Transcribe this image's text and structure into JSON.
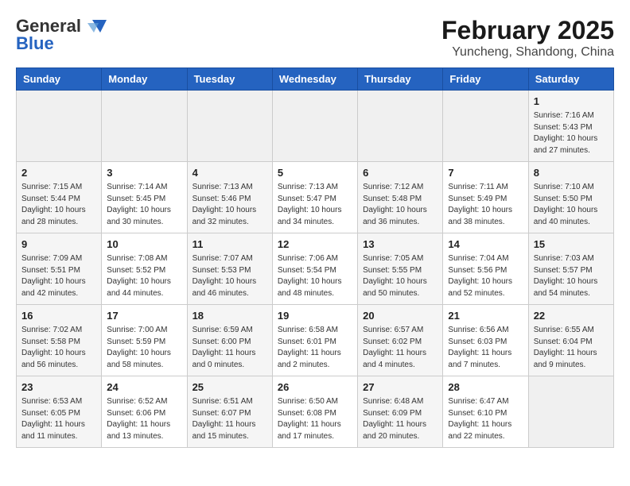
{
  "header": {
    "logo_general": "General",
    "logo_blue": "Blue",
    "title": "February 2025",
    "subtitle": "Yuncheng, Shandong, China"
  },
  "weekdays": [
    "Sunday",
    "Monday",
    "Tuesday",
    "Wednesday",
    "Thursday",
    "Friday",
    "Saturday"
  ],
  "weeks": [
    [
      {
        "day": "",
        "info": ""
      },
      {
        "day": "",
        "info": ""
      },
      {
        "day": "",
        "info": ""
      },
      {
        "day": "",
        "info": ""
      },
      {
        "day": "",
        "info": ""
      },
      {
        "day": "",
        "info": ""
      },
      {
        "day": "1",
        "info": "Sunrise: 7:16 AM\nSunset: 5:43 PM\nDaylight: 10 hours\nand 27 minutes."
      }
    ],
    [
      {
        "day": "2",
        "info": "Sunrise: 7:15 AM\nSunset: 5:44 PM\nDaylight: 10 hours\nand 28 minutes."
      },
      {
        "day": "3",
        "info": "Sunrise: 7:14 AM\nSunset: 5:45 PM\nDaylight: 10 hours\nand 30 minutes."
      },
      {
        "day": "4",
        "info": "Sunrise: 7:13 AM\nSunset: 5:46 PM\nDaylight: 10 hours\nand 32 minutes."
      },
      {
        "day": "5",
        "info": "Sunrise: 7:13 AM\nSunset: 5:47 PM\nDaylight: 10 hours\nand 34 minutes."
      },
      {
        "day": "6",
        "info": "Sunrise: 7:12 AM\nSunset: 5:48 PM\nDaylight: 10 hours\nand 36 minutes."
      },
      {
        "day": "7",
        "info": "Sunrise: 7:11 AM\nSunset: 5:49 PM\nDaylight: 10 hours\nand 38 minutes."
      },
      {
        "day": "8",
        "info": "Sunrise: 7:10 AM\nSunset: 5:50 PM\nDaylight: 10 hours\nand 40 minutes."
      }
    ],
    [
      {
        "day": "9",
        "info": "Sunrise: 7:09 AM\nSunset: 5:51 PM\nDaylight: 10 hours\nand 42 minutes."
      },
      {
        "day": "10",
        "info": "Sunrise: 7:08 AM\nSunset: 5:52 PM\nDaylight: 10 hours\nand 44 minutes."
      },
      {
        "day": "11",
        "info": "Sunrise: 7:07 AM\nSunset: 5:53 PM\nDaylight: 10 hours\nand 46 minutes."
      },
      {
        "day": "12",
        "info": "Sunrise: 7:06 AM\nSunset: 5:54 PM\nDaylight: 10 hours\nand 48 minutes."
      },
      {
        "day": "13",
        "info": "Sunrise: 7:05 AM\nSunset: 5:55 PM\nDaylight: 10 hours\nand 50 minutes."
      },
      {
        "day": "14",
        "info": "Sunrise: 7:04 AM\nSunset: 5:56 PM\nDaylight: 10 hours\nand 52 minutes."
      },
      {
        "day": "15",
        "info": "Sunrise: 7:03 AM\nSunset: 5:57 PM\nDaylight: 10 hours\nand 54 minutes."
      }
    ],
    [
      {
        "day": "16",
        "info": "Sunrise: 7:02 AM\nSunset: 5:58 PM\nDaylight: 10 hours\nand 56 minutes."
      },
      {
        "day": "17",
        "info": "Sunrise: 7:00 AM\nSunset: 5:59 PM\nDaylight: 10 hours\nand 58 minutes."
      },
      {
        "day": "18",
        "info": "Sunrise: 6:59 AM\nSunset: 6:00 PM\nDaylight: 11 hours\nand 0 minutes."
      },
      {
        "day": "19",
        "info": "Sunrise: 6:58 AM\nSunset: 6:01 PM\nDaylight: 11 hours\nand 2 minutes."
      },
      {
        "day": "20",
        "info": "Sunrise: 6:57 AM\nSunset: 6:02 PM\nDaylight: 11 hours\nand 4 minutes."
      },
      {
        "day": "21",
        "info": "Sunrise: 6:56 AM\nSunset: 6:03 PM\nDaylight: 11 hours\nand 7 minutes."
      },
      {
        "day": "22",
        "info": "Sunrise: 6:55 AM\nSunset: 6:04 PM\nDaylight: 11 hours\nand 9 minutes."
      }
    ],
    [
      {
        "day": "23",
        "info": "Sunrise: 6:53 AM\nSunset: 6:05 PM\nDaylight: 11 hours\nand 11 minutes."
      },
      {
        "day": "24",
        "info": "Sunrise: 6:52 AM\nSunset: 6:06 PM\nDaylight: 11 hours\nand 13 minutes."
      },
      {
        "day": "25",
        "info": "Sunrise: 6:51 AM\nSunset: 6:07 PM\nDaylight: 11 hours\nand 15 minutes."
      },
      {
        "day": "26",
        "info": "Sunrise: 6:50 AM\nSunset: 6:08 PM\nDaylight: 11 hours\nand 17 minutes."
      },
      {
        "day": "27",
        "info": "Sunrise: 6:48 AM\nSunset: 6:09 PM\nDaylight: 11 hours\nand 20 minutes."
      },
      {
        "day": "28",
        "info": "Sunrise: 6:47 AM\nSunset: 6:10 PM\nDaylight: 11 hours\nand 22 minutes."
      },
      {
        "day": "",
        "info": ""
      }
    ]
  ]
}
